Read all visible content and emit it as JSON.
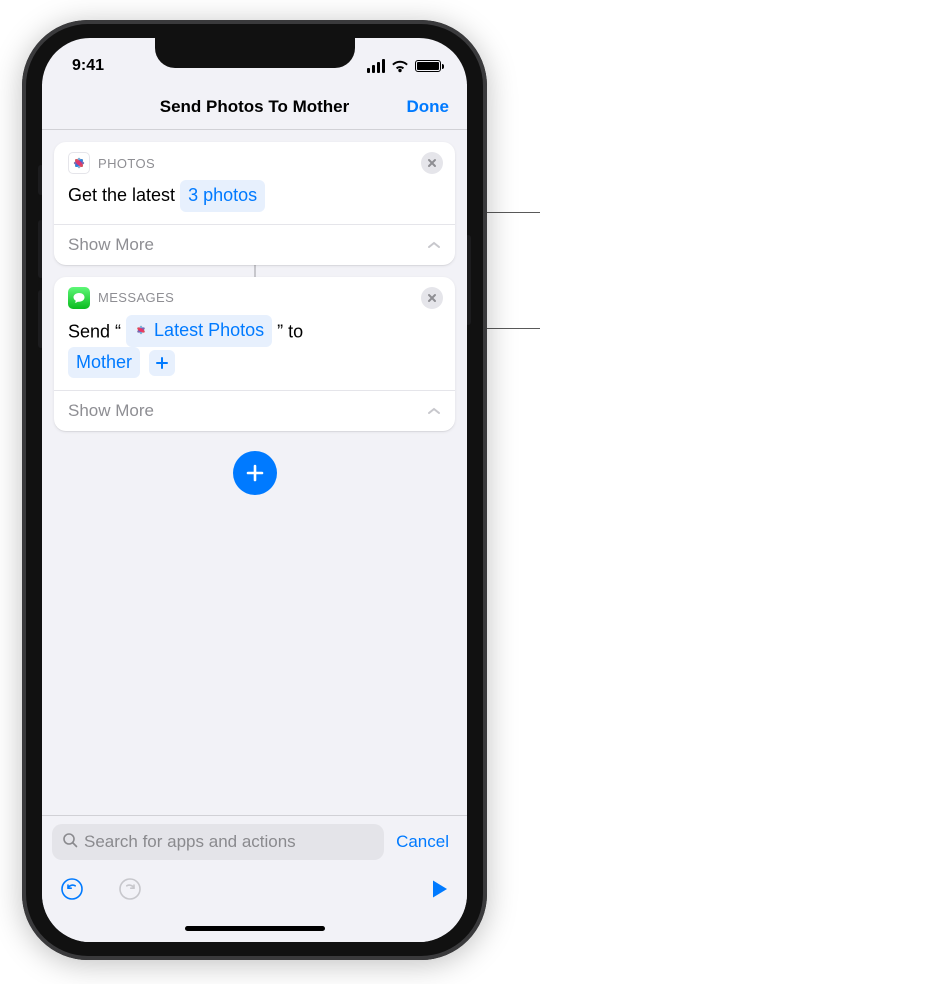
{
  "status": {
    "time": "9:41"
  },
  "nav": {
    "title": "Send Photos To Mother",
    "done": "Done"
  },
  "actions": {
    "photos": {
      "app": "PHOTOS",
      "prefix": "Get the latest ",
      "count_token": "3 photos",
      "show_more": "Show More"
    },
    "messages": {
      "app": "MESSAGES",
      "word_send": "Send",
      "word_to": "to",
      "content_token": "Latest Photos",
      "recipient_token": "Mother",
      "show_more": "Show More"
    }
  },
  "search": {
    "placeholder": "Search for apps and actions",
    "cancel": "Cancel"
  }
}
